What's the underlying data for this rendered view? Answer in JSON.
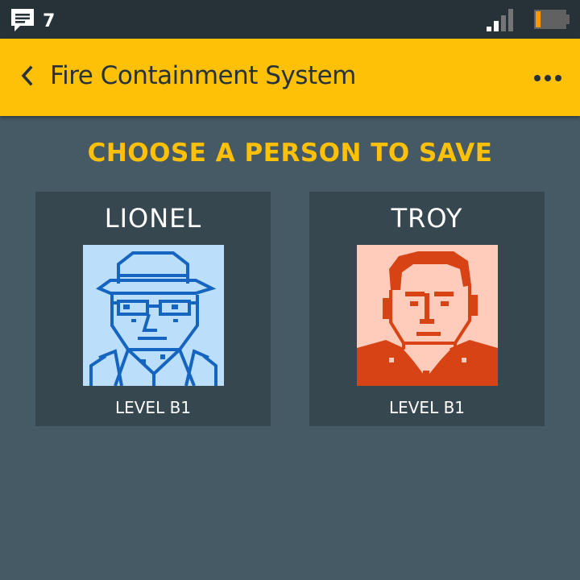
{
  "status_bar": {
    "notification_icon": "message-icon",
    "notification_count": "7",
    "signal_icon": "signal-icon",
    "battery_icon": "battery-icon",
    "battery_level": 0.15
  },
  "app_bar": {
    "back_icon": "chevron-left-icon",
    "title": "Fire Containment System",
    "more_icon": "more-horizontal-icon",
    "background": "#ffc107"
  },
  "main": {
    "heading": "CHOOSE A PERSON TO SAVE",
    "people": [
      {
        "name": "LIONEL",
        "level": "LEVEL B1",
        "portrait_colors": {
          "background": "#bbdefb",
          "ink": "#1565c0"
        }
      },
      {
        "name": "TROY",
        "level": "LEVEL B1",
        "portrait_colors": {
          "background": "#ffccbc",
          "ink": "#d84315"
        }
      }
    ]
  },
  "colors": {
    "status_bar": "#263238",
    "page_background": "#455a64",
    "card_background": "#37474f",
    "accent": "#ffc107"
  }
}
